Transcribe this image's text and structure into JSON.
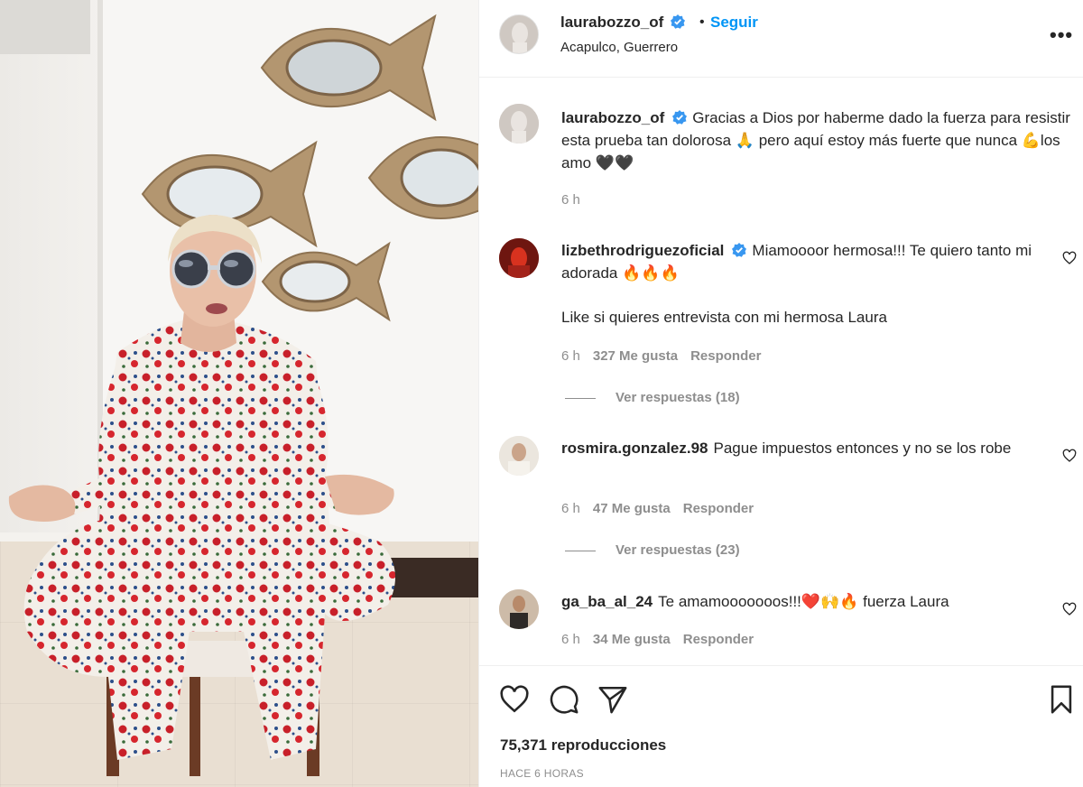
{
  "post": {
    "author": "laurabozzo_of",
    "follow_label": "Seguir",
    "separator": "•",
    "location": "Acapulco, Guerrero",
    "more_icon": "more-horizontal-icon"
  },
  "caption": {
    "author": "laurabozzo_of",
    "text": "Gracias a Dios por haberme dado la fuerza para resistir esta prueba tan dolorosa 🙏 pero aquí estoy más fuerte que nunca 💪los amo 🖤🖤",
    "time": "6 h"
  },
  "comments": [
    {
      "author": "lizbethrodriguezoficial",
      "verified": true,
      "text_line1": "Miamoooor hermosa!!! Te quiero tanto mi adorada 🔥🔥🔥",
      "text_line2": "Like si quieres entrevista con mi hermosa Laura",
      "time": "6 h",
      "likes": "327 Me gusta",
      "reply": "Responder",
      "view_replies": "Ver respuestas (18)"
    },
    {
      "author": "rosmira.gonzalez.98",
      "verified": false,
      "text": "Pague impuestos entonces y no se los robe",
      "time": "6 h",
      "likes": "47 Me gusta",
      "reply": "Responder",
      "view_replies": "Ver respuestas (23)"
    },
    {
      "author": "ga_ba_al_24",
      "verified": false,
      "text": "Te amamooooooos!!!❤️🙌🔥 fuerza Laura",
      "time": "6 h",
      "likes": "34 Me gusta",
      "reply": "Responder"
    }
  ],
  "footer": {
    "views": "75,371 reproducciones",
    "time_ago": "HACE 6 HORAS"
  },
  "colors": {
    "accent": "#0095f6",
    "verified": "#3897f0",
    "muted": "#8e8e8e",
    "text": "#262626"
  }
}
